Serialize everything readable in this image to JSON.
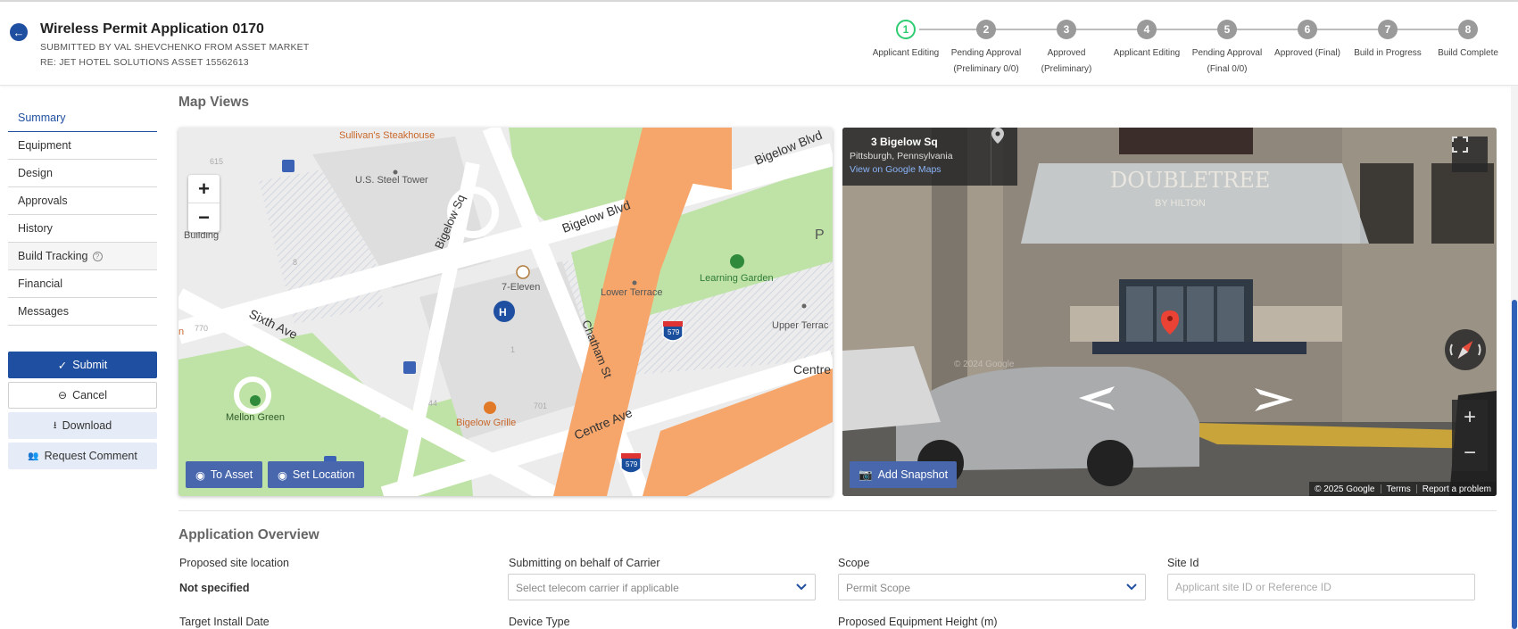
{
  "header": {
    "title": "Wireless Permit Application 0170",
    "submitted_by": "SUBMITTED BY VAL SHEVCHENKO FROM ASSET MARKET",
    "regarding": "RE: JET HOTEL SOLUTIONS ASSET 15562613"
  },
  "steps": [
    {
      "num": "1",
      "label_line1": "Applicant Editing",
      "label_line2": "",
      "active": true
    },
    {
      "num": "2",
      "label_line1": "Pending Approval",
      "label_line2": "(Preliminary 0/0)",
      "active": false
    },
    {
      "num": "3",
      "label_line1": "Approved",
      "label_line2": "(Preliminary)",
      "active": false
    },
    {
      "num": "4",
      "label_line1": "Applicant Editing",
      "label_line2": "",
      "active": false
    },
    {
      "num": "5",
      "label_line1": "Pending Approval",
      "label_line2": "(Final 0/0)",
      "active": false
    },
    {
      "num": "6",
      "label_line1": "Approved (Final)",
      "label_line2": "",
      "active": false
    },
    {
      "num": "7",
      "label_line1": "Build in Progress",
      "label_line2": "",
      "active": false
    },
    {
      "num": "8",
      "label_line1": "Build Complete",
      "label_line2": "",
      "active": false
    }
  ],
  "sidebar": {
    "items": [
      {
        "label": "Summary"
      },
      {
        "label": "Equipment"
      },
      {
        "label": "Design"
      },
      {
        "label": "Approvals"
      },
      {
        "label": "History"
      },
      {
        "label": "Build Tracking"
      },
      {
        "label": "Financial"
      },
      {
        "label": "Messages"
      }
    ],
    "actions": {
      "submit": "Submit",
      "cancel": "Cancel",
      "download": "Download",
      "request_comment": "Request Comment"
    }
  },
  "map_views": {
    "section_title": "Map Views",
    "map": {
      "labels": {
        "sullivans": "Sullivan's Steakhouse",
        "us_steel": "U.S. Steel Tower",
        "bigelow_blvd_1": "Bigelow Blvd",
        "bigelow_blvd_2": "Bigelow Blvd",
        "bigelow_sq": "Bigelow Sq",
        "building": "Building",
        "seven_eleven": "7-Eleven",
        "lower_terrace": "Lower Terrace",
        "learning_garden": "Learning Garden",
        "upper_terrace": "Upper Terrac",
        "sixth_ave": "Sixth Ave",
        "chatham_st": "Chatham St",
        "mellon_green": "Mellon Green",
        "bigelow_grille": "Bigelow Grille",
        "centre_ave_1": "Centre Ave",
        "centre_ave_2": "Centre",
        "i579_a": "579",
        "i579_b": "579",
        "p": "P",
        "n615": "615",
        "n8": "8",
        "n770": "770",
        "n44": "44",
        "n701": "701",
        "n1": "1",
        "edge_n": "n"
      },
      "zoom_in": "+",
      "zoom_out": "−",
      "to_asset": "To Asset",
      "set_location": "Set Location"
    },
    "street_view": {
      "address": "3 Bigelow Sq",
      "city": "Pittsburgh, Pennsylvania",
      "link": "View on Google Maps",
      "add_snapshot": "Add Snapshot",
      "sign_top": "DOUBLETREE",
      "sign_bottom": "BY HILTON",
      "watermark": "© 2024 Google",
      "copyright": "© 2025 Google",
      "terms": "Terms",
      "report": "Report a problem",
      "zoom_in": "+",
      "zoom_out": "−"
    }
  },
  "overview": {
    "section_title": "Application Overview",
    "proposed_site_location": {
      "label": "Proposed site location",
      "value": "Not specified"
    },
    "carrier": {
      "label": "Submitting on behalf of Carrier",
      "placeholder": "Select telecom carrier if applicable"
    },
    "scope": {
      "label": "Scope",
      "placeholder": "Permit Scope"
    },
    "site_id": {
      "label": "Site Id",
      "placeholder": "Applicant site ID or Reference ID"
    },
    "target_install_date": {
      "label": "Target Install Date"
    },
    "device_type": {
      "label": "Device Type"
    },
    "equipment_height": {
      "label": "Proposed Equipment Height (m)"
    }
  },
  "colors": {
    "primary": "#1f4fa0",
    "button_map": "#4867ad",
    "step_active": "#2ecc71",
    "step_inactive": "#9a9a9a"
  }
}
